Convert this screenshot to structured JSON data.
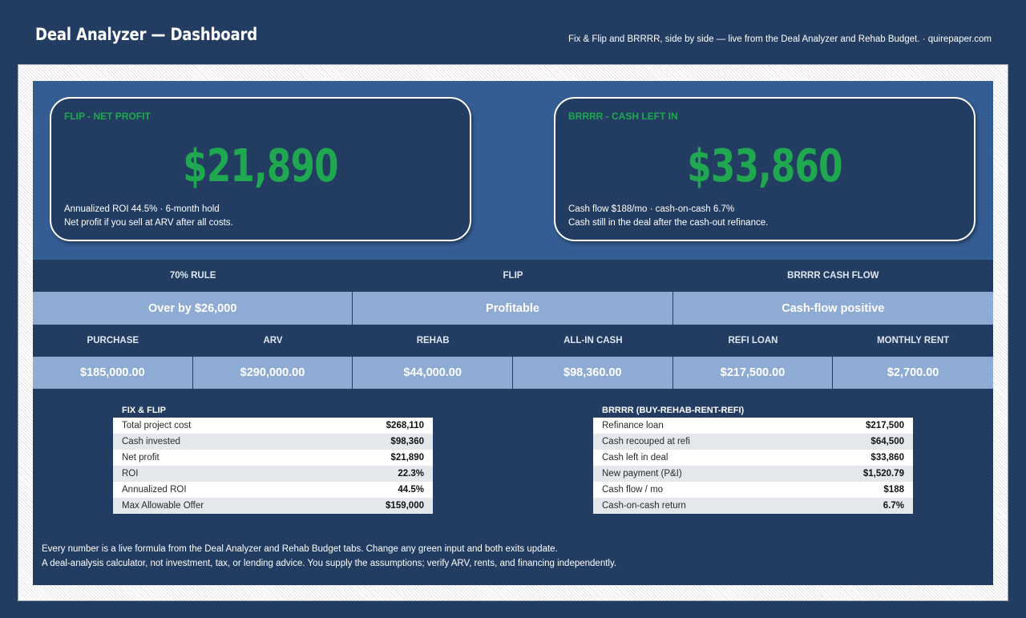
{
  "header": {
    "title": "Deal Analyzer — Dashboard",
    "subtitle": "Fix & Flip and BRRRR, side by side — live from the Deal Analyzer and Rehab Budget.  ·  quirepaper.com"
  },
  "kpi": {
    "flip": {
      "label": "FLIP - NET PROFIT",
      "value": "$21,890",
      "line1": "Annualized ROI 44.5%  ·  6-month hold",
      "line2": "Net profit if you sell at ARV after all costs."
    },
    "brrrr": {
      "label": "BRRRR - CASH LEFT IN",
      "value": "$33,860",
      "line1": "Cash flow $188/mo  ·  cash-on-cash 6.7%",
      "line2": "Cash still in the deal after the cash-out refinance."
    }
  },
  "status": {
    "headers": [
      "70% RULE",
      "FLIP",
      "BRRRR CASH FLOW"
    ],
    "values": [
      "Over by $26,000",
      "Profitable",
      "Cash-flow positive"
    ]
  },
  "metrics": {
    "headers": [
      "PURCHASE",
      "ARV",
      "REHAB",
      "ALL-IN CASH",
      "REFI LOAN",
      "MONTHLY RENT"
    ],
    "values": [
      "$185,000.00",
      "$290,000.00",
      "$44,000.00",
      "$98,360.00",
      "$217,500.00",
      "$2,700.00"
    ]
  },
  "flip_table": {
    "title": "FIX & FLIP",
    "rows": [
      {
        "label": "Total project cost",
        "value": "$268,110"
      },
      {
        "label": "Cash invested",
        "value": "$98,360"
      },
      {
        "label": "Net profit",
        "value": "$21,890"
      },
      {
        "label": "ROI",
        "value": "22.3%"
      },
      {
        "label": "Annualized ROI",
        "value": "44.5%"
      },
      {
        "label": "Max Allowable Offer",
        "value": "$159,000"
      }
    ]
  },
  "brrrr_table": {
    "title": "BRRRR (BUY-REHAB-RENT-REFI)",
    "rows": [
      {
        "label": "Refinance loan",
        "value": "$217,500"
      },
      {
        "label": "Cash recouped at refi",
        "value": "$64,500"
      },
      {
        "label": "Cash left in deal",
        "value": "$33,860"
      },
      {
        "label": "New payment (P&I)",
        "value": "$1,520.79"
      },
      {
        "label": "Cash flow / mo",
        "value": "$188"
      },
      {
        "label": "Cash-on-cash return",
        "value": "6.7%"
      }
    ]
  },
  "footnotes": {
    "line1": "Every number is a live formula from the Deal Analyzer and Rehab Budget tabs. Change any green input and both exits update.",
    "line2": "A deal-analysis calculator, not investment, tax, or lending advice. You supply the assumptions; verify ARV, rents, and financing independently."
  }
}
